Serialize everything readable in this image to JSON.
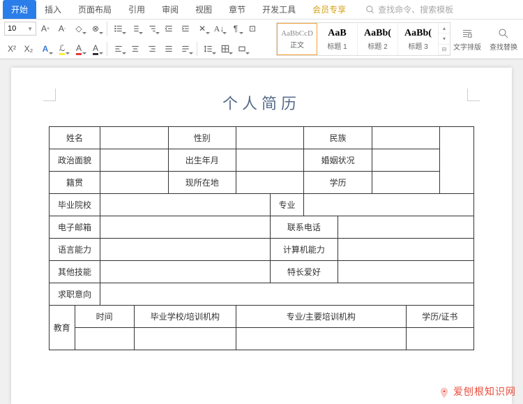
{
  "tabs": {
    "items": [
      "开始",
      "插入",
      "页面布局",
      "引用",
      "审阅",
      "视图",
      "章节",
      "开发工具",
      "会员专享"
    ],
    "active_index": 0,
    "special_index": 8,
    "search_placeholder": "查找命令、搜索模板"
  },
  "ribbon": {
    "font_size": "10",
    "styles": [
      {
        "preview": "AaBbCcD",
        "name": "正文",
        "bold": false,
        "selected": true
      },
      {
        "preview": "AaB",
        "name": "标题 1",
        "bold": true
      },
      {
        "preview": "AaBb(",
        "name": "标题 2",
        "bold": true
      },
      {
        "preview": "AaBb(",
        "name": "标题 3",
        "bold": true
      }
    ],
    "layout_label": "文字排版",
    "find_label": "查找替换"
  },
  "document": {
    "title": "个人简历",
    "rows": {
      "r1": {
        "a": "姓名",
        "b": "性别",
        "c": "民族"
      },
      "r2": {
        "a": "政治面貌",
        "b": "出生年月",
        "c": "婚姻状况"
      },
      "r3": {
        "a": "籍贯",
        "b": "现所在地",
        "c": "学历"
      },
      "r4": {
        "a": "毕业院校",
        "b": "专业"
      },
      "r5": {
        "a": "电子邮箱",
        "b": "联系电话"
      },
      "r6": {
        "a": "语言能力",
        "b": "计算机能力"
      },
      "r7": {
        "a": "其他技能",
        "b": "特长爱好"
      },
      "r8": {
        "a": "求职意向"
      },
      "r9": {
        "a": "时间",
        "b": "毕业学校/培训机构",
        "c": "专业/主要培训机构",
        "d": "学历/证书"
      },
      "r10": {
        "a": "教育"
      }
    }
  },
  "watermark": "爱刨根知识网"
}
